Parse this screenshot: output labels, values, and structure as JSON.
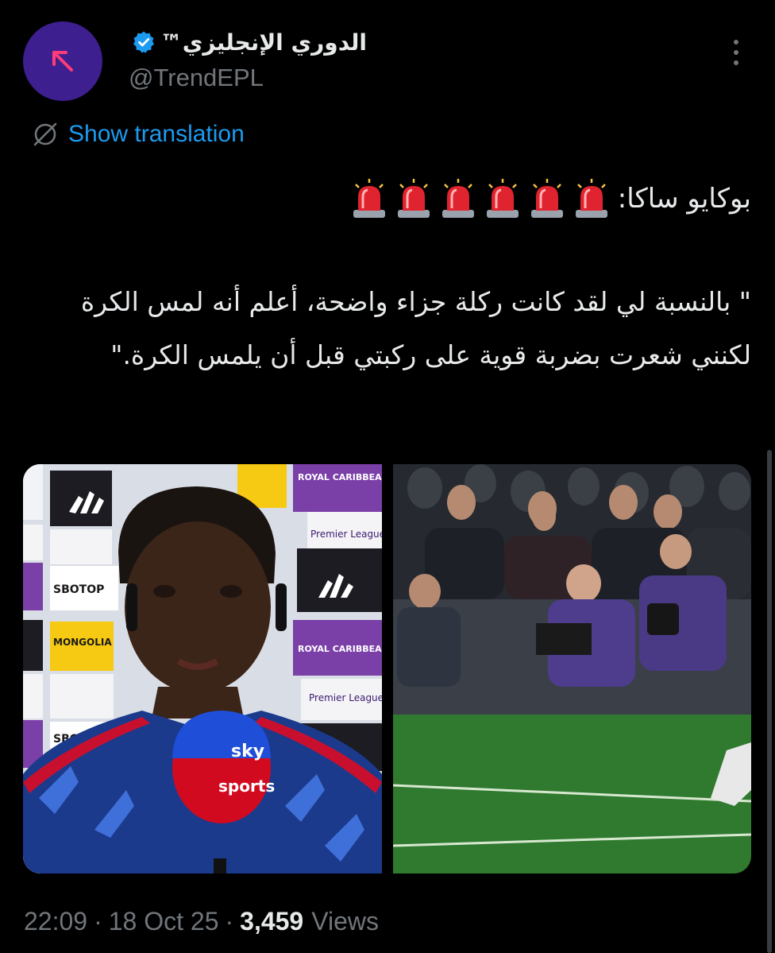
{
  "author": {
    "name": "الدوري الإنجليزي™",
    "handle": "@TrendEPL",
    "avatar_icon": "arrow-up-left-icon",
    "avatar_color": "#3d1f8f",
    "verified": true,
    "verified_color": "#1d9bf0"
  },
  "translation": {
    "label": "Show translation",
    "icon": "globe-slash-icon",
    "color": "#1d9bf0"
  },
  "tweet": {
    "speaker_line": "بوكايو ساكا:",
    "siren_emoji_count": 6,
    "siren_icon": "police-light-icon",
    "quote": "\" بالنسبة لي لقد كانت ركلة جزاء واضحة، أعلم أنه لمس الكرة لكنني شعرت بضربة قوية على ركبتي قبل أن يلمس الكرة.\""
  },
  "media": {
    "images": [
      {
        "name": "saka-interview-photo",
        "board_texts": [
          "Premier League",
          "SBOTOP",
          "MONGOLIA",
          "ROYAL CARIBBEAN"
        ],
        "mic_text": [
          "sky",
          "sports"
        ]
      },
      {
        "name": "penalty-incident-photo"
      }
    ]
  },
  "meta": {
    "time": "22:09",
    "date": "18 Oct 25",
    "views_count": "3,459",
    "views_label": "Views",
    "separator": "·"
  },
  "colors": {
    "background": "#000000",
    "text_primary": "#e7e9ea",
    "text_secondary": "#71767b",
    "accent": "#1d9bf0"
  }
}
